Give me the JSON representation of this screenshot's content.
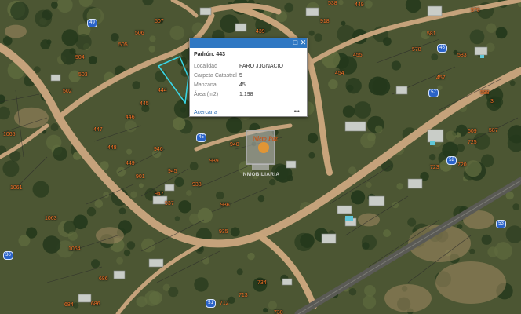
{
  "popup": {
    "title": "Padrón: 443",
    "fields": [
      {
        "name": "Localidad",
        "value": "FARO J.IGNACIO"
      },
      {
        "name": "Carpeta Catastral",
        "value": "5"
      },
      {
        "name": "Manzana",
        "value": "45"
      },
      {
        "name": "Área (m2)",
        "value": "1.198"
      }
    ],
    "zoom_link": "Acercar a",
    "more": "•••",
    "maximize_glyph": "□",
    "close_glyph": "✕"
  },
  "watermark": {
    "logo_text": "Nieto Paz",
    "brand": "INMOBILIARIA"
  },
  "parcel_labels": [
    "49",
    "506",
    "507",
    "505",
    "439",
    "503",
    "502",
    "504",
    "444",
    "445",
    "446",
    "447",
    "448",
    "449",
    "940",
    "946",
    "945",
    "947",
    "939",
    "938",
    "937",
    "936",
    "935",
    "901",
    "1061",
    "1063",
    "1064",
    "1065",
    "686",
    "686",
    "684",
    "713",
    "712",
    "730",
    "734",
    "609",
    "720",
    "723",
    "725",
    "587",
    "588",
    "570",
    "455",
    "454",
    "457",
    "449",
    "578",
    "583",
    "918",
    "581",
    "538",
    "3"
  ],
  "block_badges": [
    "49",
    "45",
    "46",
    "57",
    "51",
    "52",
    "36",
    "53"
  ],
  "colors": {
    "popup_header": "#2f78c3",
    "label": "#ff7a2a",
    "highlight": "#39d7e8",
    "road": "#c9a27a"
  }
}
